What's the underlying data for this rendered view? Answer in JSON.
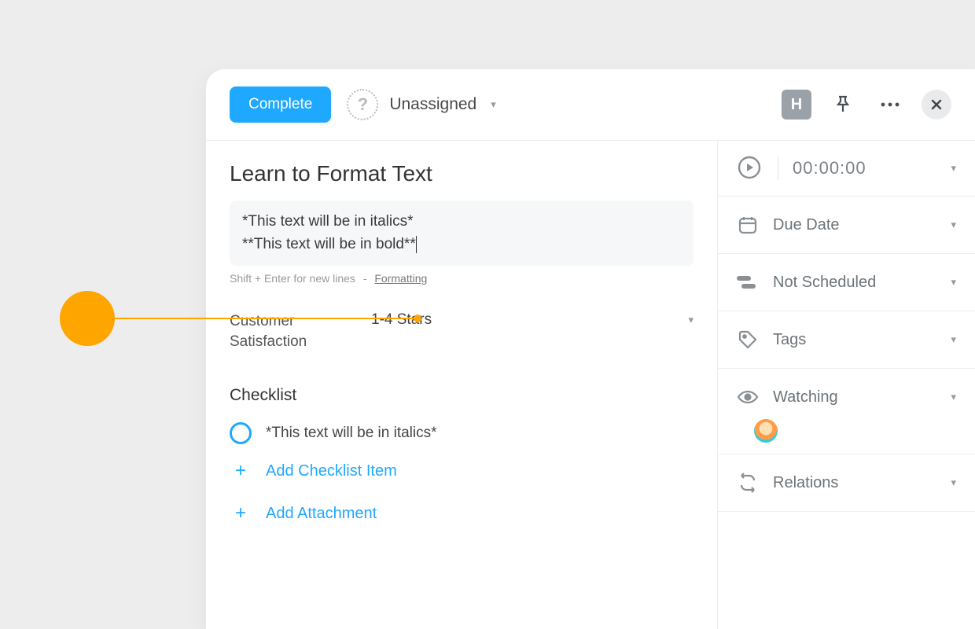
{
  "toolbar": {
    "complete_label": "Complete",
    "assignee_label": "Unassigned",
    "h_badge": "H"
  },
  "task": {
    "title": "Learn to Format Text",
    "description_line1": "*This text will be in italics*",
    "description_line2": "**This text will be in bold**",
    "hint_text": "Shift + Enter for new lines",
    "hint_sep": "-",
    "formatting_link": "Formatting"
  },
  "custom_fields": [
    {
      "label": "Customer Satisfaction",
      "value": "1-4 Stars"
    }
  ],
  "checklist": {
    "heading": "Checklist",
    "items": [
      {
        "text": "*This text will be in italics*",
        "done": false
      }
    ],
    "add_item_label": "Add Checklist Item",
    "add_attachment_label": "Add Attachment"
  },
  "sidebar": {
    "timer": "00:00:00",
    "rows": {
      "due_date": "Due Date",
      "schedule": "Not Scheduled",
      "tags": "Tags",
      "watching": "Watching",
      "relations": "Relations"
    }
  }
}
